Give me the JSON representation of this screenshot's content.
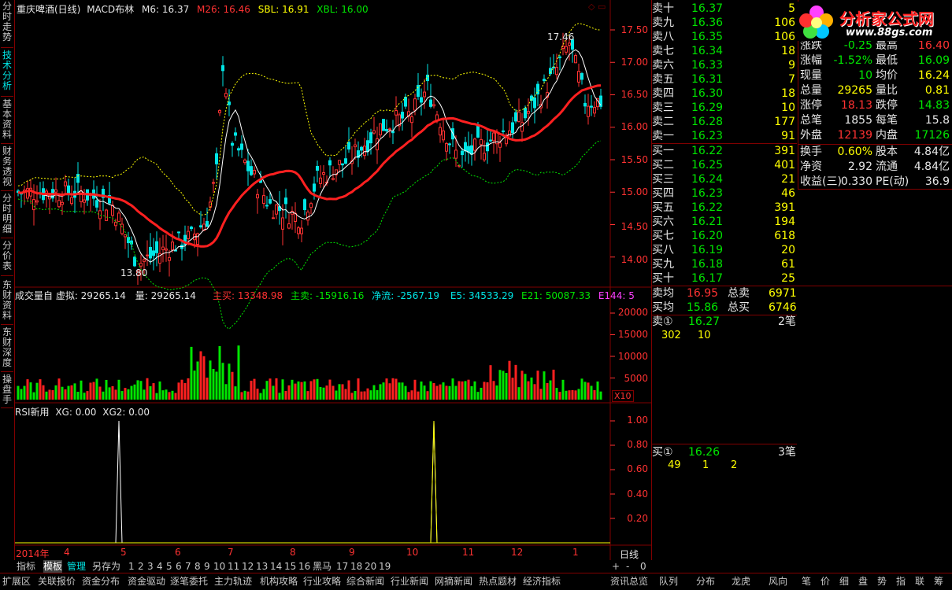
{
  "left_tabs": [
    "分时走势",
    "技术分析",
    "基本资料",
    "财务透视",
    "分时明细",
    "分价表",
    "东财资料",
    "东财深度",
    "操盘手"
  ],
  "chart": {
    "title": "重庆啤酒(日线)",
    "indicator": "MACD布林",
    "m6": "M6: 16.37",
    "m26": "M26: 16.46",
    "sbl": "SBL: 16.91",
    "xbl": "XBL: 16.00",
    "high_mark": "17.46",
    "low_mark": "13.80",
    "price_axis": [
      "17.50",
      "17.00",
      "16.50",
      "16.00",
      "15.50",
      "15.00",
      "14.50",
      "14.00"
    ],
    "vol_header": "成交量自  虚拟: 29265.14",
    "vol_amount": "量: 29265.14",
    "zhumai": "主买: 13348.98",
    "zhumai2": "主卖: -15916.16",
    "jingliu": "净流: -2567.19",
    "e5": "E5: 34533.29",
    "e21": "E21: 50087.33",
    "e144": "E144: 5",
    "vol_axis": [
      "20000",
      "15000",
      "10000",
      "5000"
    ],
    "vol_unit": "X10",
    "rsi_header": "RSI新用",
    "rsi_xg": "XG: 0.00",
    "rsi_xg2": "XG2: 0.00",
    "rsi_axis": [
      "1.00",
      "0.80",
      "0.60",
      "0.40",
      "0.20"
    ],
    "date_labels": [
      "2014年",
      "4",
      "5",
      "6",
      "7",
      "8",
      "9",
      "10",
      "11",
      "12",
      "1"
    ],
    "period": "日线"
  },
  "quote": {
    "sell": [
      {
        "label": "卖十",
        "price": "16.37",
        "vol": "5"
      },
      {
        "label": "卖九",
        "price": "16.36",
        "vol": "106"
      },
      {
        "label": "卖八",
        "price": "16.35",
        "vol": "106"
      },
      {
        "label": "卖七",
        "price": "16.34",
        "vol": "18"
      },
      {
        "label": "卖六",
        "price": "16.33",
        "vol": "9"
      },
      {
        "label": "卖五",
        "price": "16.31",
        "vol": "7"
      },
      {
        "label": "卖四",
        "price": "16.30",
        "vol": "18"
      },
      {
        "label": "卖三",
        "price": "16.29",
        "vol": "10"
      },
      {
        "label": "卖二",
        "price": "16.28",
        "vol": "177"
      },
      {
        "label": "卖一",
        "price": "16.23",
        "vol": "91"
      }
    ],
    "buy": [
      {
        "label": "买一",
        "price": "16.22",
        "vol": "391"
      },
      {
        "label": "买二",
        "price": "16.25",
        "vol": "401"
      },
      {
        "label": "买三",
        "price": "16.24",
        "vol": "21"
      },
      {
        "label": "买四",
        "price": "16.23",
        "vol": "46"
      },
      {
        "label": "买五",
        "price": "16.22",
        "vol": "391"
      },
      {
        "label": "买六",
        "price": "16.21",
        "vol": "194"
      },
      {
        "label": "买七",
        "price": "16.20",
        "vol": "618"
      },
      {
        "label": "买八",
        "price": "16.19",
        "vol": "20"
      },
      {
        "label": "买九",
        "price": "16.18",
        "vol": "61"
      },
      {
        "label": "买十",
        "price": "16.17",
        "vol": "25"
      }
    ],
    "sell_avg_label": "卖均",
    "sell_avg": "16.95",
    "sell_total_label": "总卖",
    "sell_total": "6971",
    "buy_avg_label": "买均",
    "buy_avg": "15.86",
    "buy_total_label": "总买",
    "buy_total": "6746",
    "sell1_label": "卖①",
    "sell1_price": "16.27",
    "sell1_count": "2笔",
    "sell1_orders": [
      "302",
      "10"
    ],
    "buy1_label": "买①",
    "buy1_price": "16.26",
    "buy1_count": "3笔",
    "buy1_orders": [
      "49",
      "1",
      "2"
    ]
  },
  "stats": {
    "rows": [
      {
        "l1": "涨跌",
        "v1": "-0.25",
        "l2": "最高",
        "v2": "16.40"
      },
      {
        "l1": "涨幅",
        "v1": "-1.52%",
        "l2": "最低",
        "v2": "16.09"
      },
      {
        "l1": "现量",
        "v1": "10",
        "l2": "均价",
        "v2": "16.24"
      },
      {
        "l1": "总量",
        "v1": "29265",
        "l2": "量比",
        "v2": "0.81"
      },
      {
        "l1": "涨停",
        "v1": "18.13",
        "l2": "跌停",
        "v2": "14.83"
      },
      {
        "l1": "总笔",
        "v1": "1855",
        "l2": "每笔",
        "v2": "15.8"
      },
      {
        "l1": "外盘",
        "v1": "12139",
        "l2": "内盘",
        "v2": "17126"
      },
      {
        "l1": "换手",
        "v1": "0.60%",
        "l2": "股本",
        "v2": "4.84亿"
      },
      {
        "l1": "净资",
        "v1": "2.92",
        "l2": "流通",
        "v2": "4.84亿"
      },
      {
        "l1": "收益(三)",
        "v1": "0.330",
        "l2": "PE(动)",
        "v2": "36.9"
      }
    ]
  },
  "logo": {
    "name": "分析家公式网",
    "url": "www.88gs.com"
  },
  "bottom1": [
    "指标",
    "模板",
    "管理",
    "另存为",
    "1",
    "2",
    "3",
    "4",
    "5",
    "6",
    "7",
    "8",
    "9",
    "10",
    "11",
    "12",
    "13",
    "14",
    "15",
    "16",
    "黑马",
    "17",
    "18",
    "20",
    "19"
  ],
  "bottom1_right": [
    "+",
    "-",
    "0"
  ],
  "bottom2": [
    "扩展区",
    "关联报价",
    "资金分布",
    "资金驱动",
    "逐笔委托",
    "主力轨迹",
    "机构攻略",
    "行业攻略",
    "综合新闻",
    "行业新闻",
    "网摘新闻",
    "热点题材",
    "经济指标"
  ],
  "bottom2_right": [
    "资讯总览",
    "队列",
    "分布",
    "龙虎",
    "风向"
  ],
  "bottom2_far": [
    "笔",
    "价",
    "细",
    "盘",
    "势",
    "指",
    "联",
    "筹"
  ],
  "colors": {
    "up": "#ff3232",
    "down": "#00e600",
    "border": "#800000",
    "accent": "#ffff00"
  }
}
